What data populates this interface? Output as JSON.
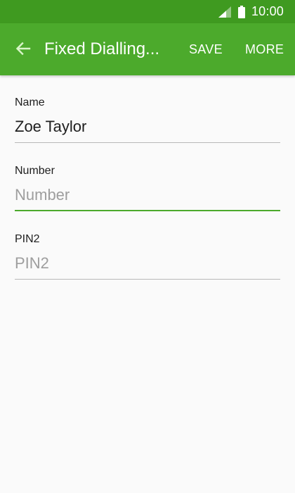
{
  "status_bar": {
    "time": "10:00",
    "icons": [
      "signal-icon",
      "battery-icon"
    ]
  },
  "app_bar": {
    "back_icon": "back-arrow-icon",
    "title": "Fixed Dialling...",
    "save_label": "SAVE",
    "more_label": "MORE"
  },
  "form": {
    "name": {
      "label": "Name",
      "value": "Zoe Taylor",
      "placeholder": ""
    },
    "number": {
      "label": "Number",
      "value": "",
      "placeholder": "Number",
      "focused": true
    },
    "pin2": {
      "label": "PIN2",
      "value": "",
      "placeholder": "PIN2"
    }
  },
  "colors": {
    "status_bar": "#3f9a20",
    "app_bar": "#4caa2c",
    "accent": "#4caa2c",
    "background": "#fafafa",
    "back_arrow": "#d8f5c8",
    "placeholder": "#9e9e9e",
    "divider": "#b8b8b8"
  }
}
